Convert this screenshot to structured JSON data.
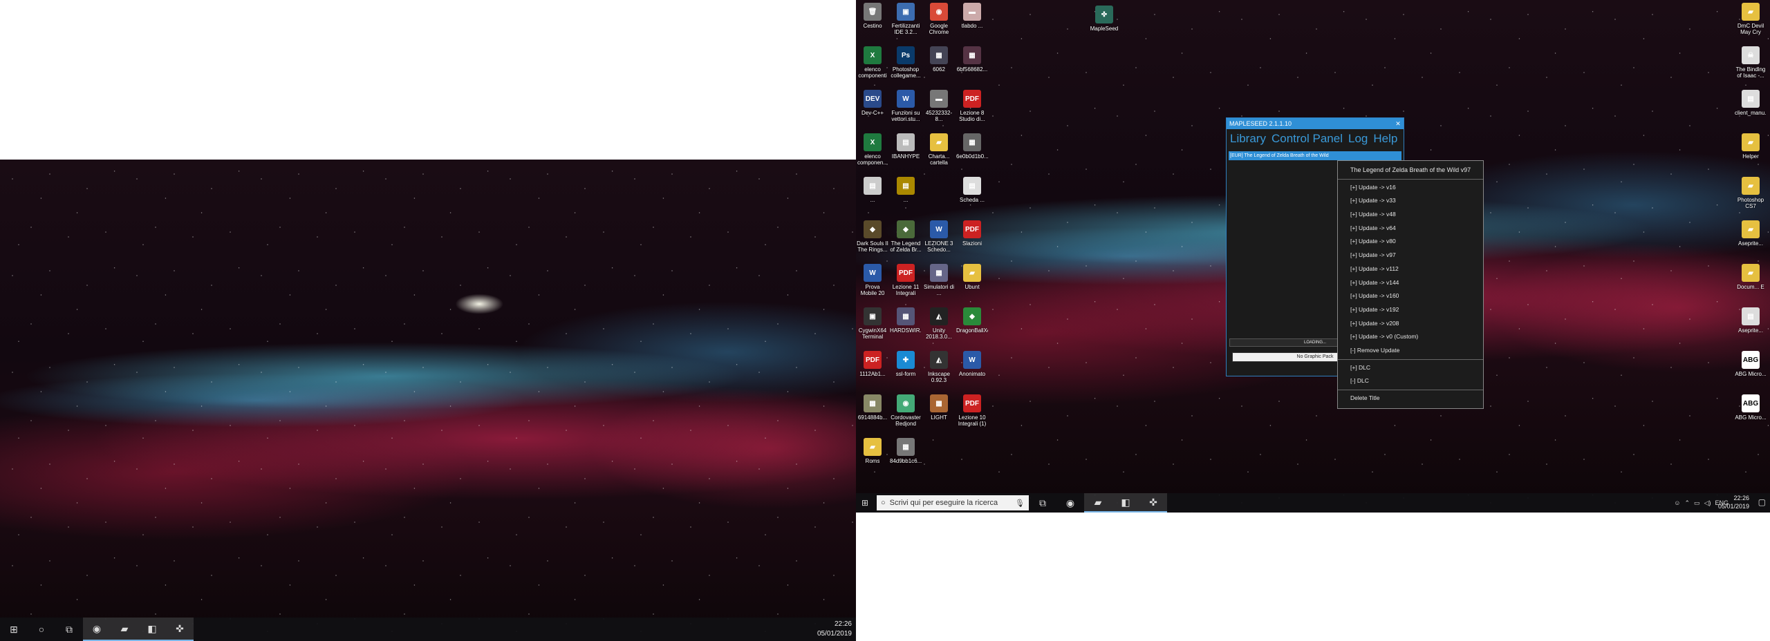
{
  "left_screen": {
    "taskbar": {
      "start_icon": "windows-logo-icon",
      "apps": [
        {
          "name": "cortana-icon",
          "glyph": "○"
        },
        {
          "name": "task-view-icon",
          "glyph": "⧉"
        },
        {
          "name": "chrome-icon",
          "glyph": "◉"
        },
        {
          "name": "file-explorer-icon",
          "glyph": "▰"
        },
        {
          "name": "store-icon",
          "glyph": "◧"
        },
        {
          "name": "mapleseed-icon",
          "glyph": "✜"
        }
      ],
      "time": "22:26",
      "date": "05/01/2019"
    }
  },
  "right_screen": {
    "desktop_icons": [
      {
        "label": "Cestino",
        "glyph": "🗑",
        "color": "#777"
      },
      {
        "label": "Fertilizzanti IDE 3.2...",
        "glyph": "▣",
        "color": "#3c6cb0"
      },
      {
        "label": "Google Chrome",
        "glyph": "◉",
        "color": "#d94a38"
      },
      {
        "label": "tlabdo ...",
        "glyph": "▬",
        "color": "#caa"
      },
      {
        "label": "elenco componenti",
        "glyph": "X",
        "color": "#1f7a3f"
      },
      {
        "label": "Photoshop collegame...",
        "glyph": "Ps",
        "color": "#0a3a6a"
      },
      {
        "label": "6062",
        "glyph": "▦",
        "color": "#445"
      },
      {
        "label": "6bf568682...",
        "glyph": "▦",
        "color": "#534"
      },
      {
        "label": "Dev-C++",
        "glyph": "DEV",
        "color": "#2a4a8a"
      },
      {
        "label": "Funzioni su vettori.stu...",
        "glyph": "W",
        "color": "#2b5aa8"
      },
      {
        "label": "45232332-8...",
        "glyph": "▬",
        "color": "#777"
      },
      {
        "label": "Lezione 8 Studio di...",
        "glyph": "PDF",
        "color": "#c22"
      },
      {
        "label": "elenco componen...",
        "glyph": "X",
        "color": "#1f7a3f"
      },
      {
        "label": "IBANHYPE",
        "glyph": "▤",
        "color": "#bbb"
      },
      {
        "label": "Charta... cartella",
        "glyph": "▰",
        "color": "#e6c040"
      },
      {
        "label": "6e0b0d1b0...",
        "glyph": "▦",
        "color": "#666"
      },
      {
        "label": "...",
        "glyph": "▤",
        "color": "#ccc"
      },
      {
        "label": "...",
        "glyph": "▤",
        "color": "#a80"
      },
      {
        "label": "",
        "glyph": "",
        "color": "transparent"
      },
      {
        "label": "Scheda ...",
        "glyph": "▤",
        "color": "#ddd"
      },
      {
        "label": "Dark Souls II The Rings...",
        "glyph": "◆",
        "color": "#5a4a2a"
      },
      {
        "label": "The Legend of Zelda Br...",
        "glyph": "◆",
        "color": "#4a6a3a"
      },
      {
        "label": "LEZIONE 3 Schedo...",
        "glyph": "W",
        "color": "#2b5aa8"
      },
      {
        "label": "Slazioni",
        "glyph": "PDF",
        "color": "#c22"
      },
      {
        "label": "Prova Mobile 20",
        "glyph": "W",
        "color": "#2b5aa8"
      },
      {
        "label": "Lezione 11 Integrali",
        "glyph": "PDF",
        "color": "#c22"
      },
      {
        "label": "Simulatori di ...",
        "glyph": "▦",
        "color": "#668"
      },
      {
        "label": "Ubunt",
        "glyph": "▰",
        "color": "#e6c040"
      },
      {
        "label": "CygwinX64 Terminal",
        "glyph": "▣",
        "color": "#333"
      },
      {
        "label": "HARDSWIR...",
        "glyph": "▦",
        "color": "#557"
      },
      {
        "label": "Unity 2018.3.0...",
        "glyph": "◭",
        "color": "#222"
      },
      {
        "label": "DragonBallXe...",
        "glyph": "◆",
        "color": "#2a8a3a"
      },
      {
        "label": "1112Ab1...",
        "glyph": "PDF",
        "color": "#c22"
      },
      {
        "label": "ssl-form",
        "glyph": "✚",
        "color": "#1a8ad4"
      },
      {
        "label": "Inkscape 0.92.3",
        "glyph": "◭",
        "color": "#333"
      },
      {
        "label": "Anonimato",
        "glyph": "W",
        "color": "#2b5aa8"
      },
      {
        "label": "6914884b...",
        "glyph": "▦",
        "color": "#886"
      },
      {
        "label": "Cordovaster Redjond",
        "glyph": "◉",
        "color": "#4a7"
      },
      {
        "label": "LIGHT",
        "glyph": "▦",
        "color": "#a63"
      },
      {
        "label": "Lezione 10 Integrali (1)",
        "glyph": "PDF",
        "color": "#c22"
      },
      {
        "label": "Roms",
        "glyph": "▰",
        "color": "#e6c040"
      },
      {
        "label": "84d9bb1c6...",
        "glyph": "▦",
        "color": "#777"
      }
    ],
    "mid_icon": {
      "label": "MapleSeed",
      "glyph": "✜",
      "color": "#2a6a5a"
    },
    "right_icons": [
      {
        "label": "DmC Devil May Cry",
        "glyph": "▰",
        "color": "#e6c040"
      },
      {
        "label": "The Binding of Isaac -...",
        "glyph": "☠",
        "color": "#ddd"
      },
      {
        "label": "client_manu...",
        "glyph": "▤",
        "color": "#ddd"
      },
      {
        "label": "Helper",
        "glyph": "▰",
        "color": "#e6c040"
      },
      {
        "label": "Photoshop CS7",
        "glyph": "▰",
        "color": "#e6c040"
      },
      {
        "label": "Aseprite...",
        "glyph": "▰",
        "color": "#e6c040"
      },
      {
        "label": "Docum... E",
        "glyph": "▰",
        "color": "#e6c040"
      },
      {
        "label": "Aseprite...",
        "glyph": "▤",
        "color": "#ddd"
      },
      {
        "label": "ABG Micro...",
        "glyph": "ABG",
        "color": "#fff"
      },
      {
        "label": "ABG Micro...",
        "glyph": "ABG",
        "color": "#fff"
      }
    ],
    "app": {
      "title": "MAPLESEED 2.1.1.10",
      "close": "✕",
      "menu": [
        "Library",
        "Control Panel",
        "Log",
        "Help"
      ],
      "selected_title": "[EUR] The Legend of Zelda Breath of the Wild",
      "loading": "LOADING...",
      "graphic_pack": "No Graphic Pack"
    },
    "context_menu": {
      "header": "The Legend of Zelda Breath of the Wild v97",
      "updates": [
        "[+] Update -> v16",
        "[+] Update -> v33",
        "[+] Update -> v48",
        "[+] Update -> v64",
        "[+] Update -> v80",
        "[+] Update -> v97",
        "[+] Update -> v112",
        "[+] Update -> v144",
        "[+] Update -> v160",
        "[+] Update -> v192",
        "[+] Update -> v208",
        "[+] Update -> v0 (Custom)",
        "[-] Remove Update"
      ],
      "dlc": [
        "[+] DLC",
        "[-] DLC"
      ],
      "delete": "Delete Title"
    },
    "taskbar": {
      "search_placeholder": "Scrivi qui per eseguire la ricerca",
      "language": "ENG",
      "time": "22:26",
      "date": "05/01/2019"
    }
  }
}
